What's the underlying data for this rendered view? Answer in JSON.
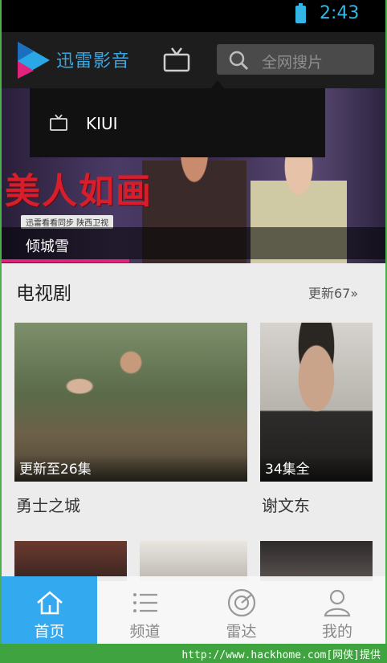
{
  "status_bar": {
    "time": "2:43"
  },
  "header": {
    "app_title": "迅雷影音",
    "search_placeholder": "全网搜片"
  },
  "popup": {
    "item_label": "KIUI"
  },
  "banner": {
    "calligraphy": "美人如画",
    "strip_text": "迅雷看看同步 陕西卫视",
    "caption": "倾城雪"
  },
  "section": {
    "title": "电视剧",
    "more": "更新67»"
  },
  "cards": [
    {
      "badge": "更新至26集",
      "title": "勇士之城"
    },
    {
      "badge": "34集全",
      "title": "谢文东"
    }
  ],
  "bottom_nav": [
    {
      "label": "首页",
      "icon": "home-icon",
      "active": true
    },
    {
      "label": "频道",
      "icon": "list-icon",
      "active": false
    },
    {
      "label": "雷达",
      "icon": "radar-icon",
      "active": false
    },
    {
      "label": "我的",
      "icon": "user-icon",
      "active": false
    }
  ],
  "watermark": "http://www.hackhome.com[网侠]提供",
  "colors": {
    "accent": "#33aaf0",
    "status_text": "#33b5e5",
    "banner_progress": "#e0237c"
  }
}
